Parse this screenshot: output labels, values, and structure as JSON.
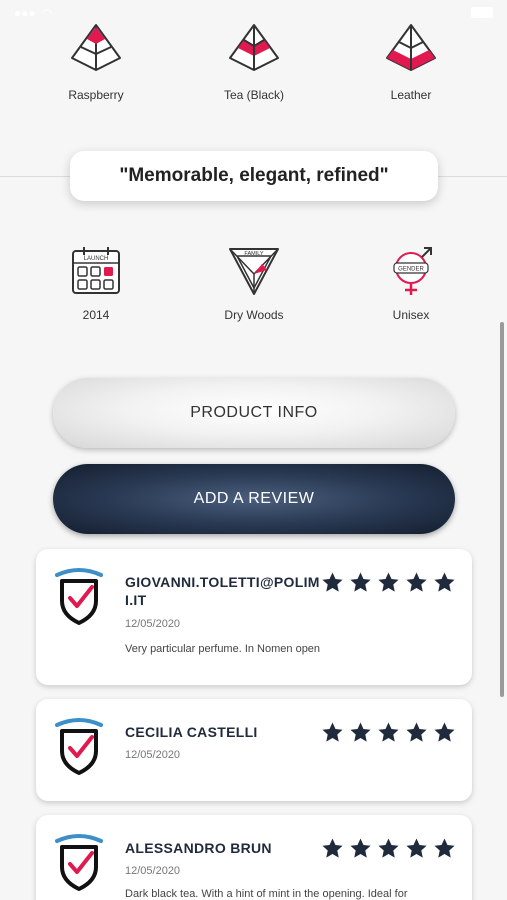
{
  "notes": [
    {
      "label": "Raspberry",
      "icon": "pyramid-top-icon"
    },
    {
      "label": "Tea (Black)",
      "icon": "pyramid-heart-icon"
    },
    {
      "label": "Leather",
      "icon": "pyramid-base-icon"
    }
  ],
  "tagline": "\"Memorable, elegant, refined\"",
  "attributes": [
    {
      "label": "2014",
      "icon": "launch-calendar-icon",
      "icon_text": "LAUNCH"
    },
    {
      "label": "Dry Woods",
      "icon": "family-icon",
      "icon_text": "FAMILY"
    },
    {
      "label": "Unisex",
      "icon": "gender-icon",
      "icon_text": "GENDER"
    }
  ],
  "buttons": {
    "product_info": "PRODUCT INFO",
    "add_review": "ADD A REVIEW"
  },
  "reviews": [
    {
      "user": "GIOVANNI.TOLETTI@POLIMI.IT",
      "date": "12/05/2020",
      "text": "Very particular perfume. In Nomen open",
      "rating": 5
    },
    {
      "user": "CECILIA CASTELLI",
      "date": "12/05/2020",
      "text": "",
      "rating": 5
    },
    {
      "user": "ALESSANDRO BRUN",
      "date": "12/05/2020",
      "text": "Dark black tea. With a hint of mint in the opening. Ideal for",
      "rating": 5
    }
  ],
  "colors": {
    "accent": "#e0194f",
    "navy": "#1f2a3c",
    "shield_blue": "#3c8fc7"
  }
}
